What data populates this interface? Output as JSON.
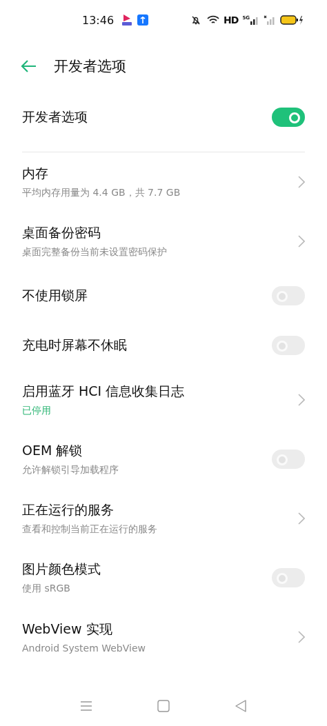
{
  "status_bar": {
    "time": "13:46",
    "network": "HD",
    "cellular": "5G"
  },
  "header": {
    "title": "开发者选项"
  },
  "master": {
    "label": "开发者选项",
    "on": true
  },
  "items": [
    {
      "kind": "link",
      "title": "内存",
      "subtitle": "平均内存用量为 4.4 GB，共 7.7 GB"
    },
    {
      "kind": "link",
      "title": "桌面备份密码",
      "subtitle": "桌面完整备份当前未设置密码保护"
    },
    {
      "kind": "switch",
      "title": "不使用锁屏",
      "on": false
    },
    {
      "kind": "switch",
      "title": "充电时屏幕不休眠",
      "on": false
    },
    {
      "kind": "link",
      "title": "启用蓝牙 HCI 信息收集日志",
      "subtitle": "已停用",
      "accent": true
    },
    {
      "kind": "switch",
      "title": "OEM 解锁",
      "subtitle": "允许解锁引导加载程序",
      "on": false
    },
    {
      "kind": "link",
      "title": "正在运行的服务",
      "subtitle": "查看和控制当前正在运行的服务"
    },
    {
      "kind": "switch",
      "title": "图片颜色模式",
      "subtitle": "使用 sRGB",
      "on": false
    },
    {
      "kind": "link",
      "title": "WebView 实现",
      "subtitle": "Android System WebView"
    }
  ]
}
